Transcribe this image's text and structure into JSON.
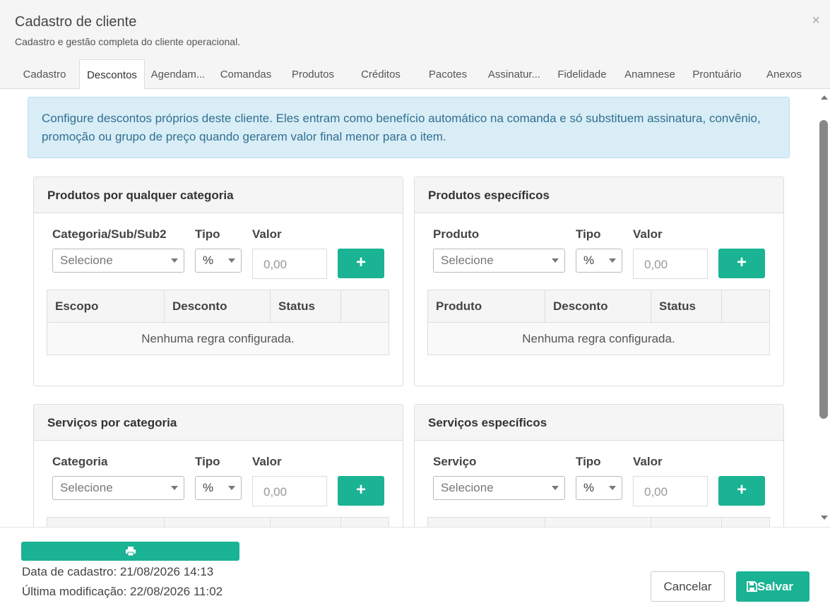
{
  "modal": {
    "title": "Cadastro de cliente",
    "subtitle": "Cadastro e gestão completa do cliente operacional.",
    "close": "×"
  },
  "tabs": [
    {
      "label": "Cadastro"
    },
    {
      "label": "Descontos",
      "active": true
    },
    {
      "label": "Agendam..."
    },
    {
      "label": "Comandas"
    },
    {
      "label": "Produtos"
    },
    {
      "label": "Créditos"
    },
    {
      "label": "Pacotes"
    },
    {
      "label": "Assinatur..."
    },
    {
      "label": "Fidelidade"
    },
    {
      "label": "Anamnese"
    },
    {
      "label": "Prontuário"
    },
    {
      "label": "Anexos"
    }
  ],
  "alert": "Configure descontos próprios deste cliente. Eles entram como benefício automático na comanda e só substituem assinatura, convênio, promoção ou grupo de preço quando gerarem valor final menor para o item.",
  "panels": [
    {
      "title": "Produtos por qualquer categoria",
      "field1_label": "Categoria/Sub/Sub2",
      "field1_value": "Selecione",
      "tipo_label": "Tipo",
      "tipo_value": "%",
      "valor_label": "Valor",
      "valor_placeholder": "0,00",
      "add": "+",
      "columns": [
        "Escopo",
        "Desconto",
        "Status"
      ],
      "empty": "Nenhuma regra configurada."
    },
    {
      "title": "Produtos específicos",
      "field1_label": "Produto",
      "field1_value": "Selecione",
      "tipo_label": "Tipo",
      "tipo_value": "%",
      "valor_label": "Valor",
      "valor_placeholder": "0,00",
      "add": "+",
      "columns": [
        "Produto",
        "Desconto",
        "Status"
      ],
      "empty": "Nenhuma regra configurada."
    },
    {
      "title": "Serviços por categoria",
      "field1_label": "Categoria",
      "field1_value": "Selecione",
      "tipo_label": "Tipo",
      "tipo_value": "%",
      "valor_label": "Valor",
      "valor_placeholder": "0,00",
      "add": "+"
    },
    {
      "title": "Serviços específicos",
      "field1_label": "Serviço",
      "field1_value": "Selecione",
      "tipo_label": "Tipo",
      "tipo_value": "%",
      "valor_label": "Valor",
      "valor_placeholder": "0,00",
      "add": "+"
    }
  ],
  "footer": {
    "created": "Data de cadastro: 21/08/2026 14:13",
    "modified": "Última modificação: 22/08/2026 11:02",
    "cancel": "Cancelar",
    "save": "Salvar"
  },
  "colors": {
    "accent": "#1ab394",
    "alert_bg": "#d9edf7",
    "alert_text": "#31708f"
  }
}
